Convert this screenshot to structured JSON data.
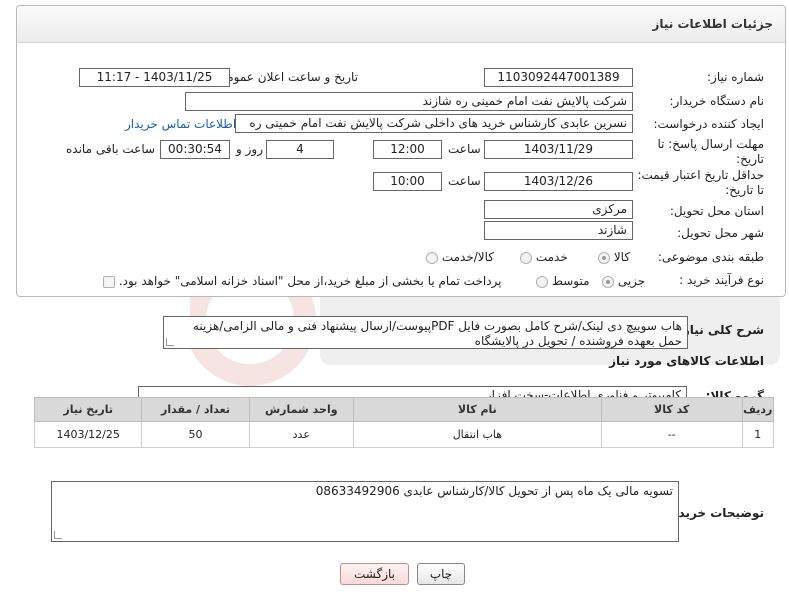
{
  "panel": {
    "title": "جزئیات اطلاعات نیاز"
  },
  "fields": {
    "need_number": {
      "label": "شماره نیاز:",
      "value": "1103092447001389"
    },
    "announce": {
      "label": "تاریخ و ساعت اعلان عمومی:",
      "value": "1403/11/25 - 11:17"
    },
    "buyer_org": {
      "label": "نام دستگاه خریدار:",
      "value": "شرکت پالایش نفت امام خمینی  ره  شازند"
    },
    "requester": {
      "label": "ایجاد کننده درخواست:",
      "value": "نسرین عابدی کارشناس خرید های داخلی  شرکت پالایش نفت امام خمینی  ره",
      "contact_link": "اطلاعات تماس خریدار"
    },
    "deadline": {
      "label": "مهلت ارسال پاسخ: تا تاریخ:",
      "date": "1403/11/29",
      "time_label": "ساعت",
      "time": "12:00",
      "days": "4",
      "days_label": "روز و",
      "remaining": "00:30:54",
      "remaining_label": "ساعت باقی مانده"
    },
    "min_price_validity": {
      "label": "حداقل تاریخ اعتبار قیمت: تا تاریخ:",
      "date": "1403/12/26",
      "time_label": "ساعت",
      "time": "10:00"
    },
    "province": {
      "label": "استان محل تحویل:",
      "value": "مرکزی"
    },
    "city": {
      "label": "شهر محل تحویل:",
      "value": "شازند"
    },
    "category": {
      "label": "طبقه بندی موضوعی:",
      "options": [
        "کالا",
        "خدمت",
        "کالا/خدمت"
      ],
      "selected": "کالا"
    },
    "process": {
      "label": "نوع فرآیند خرید :",
      "options": [
        "جزیی",
        "متوسط"
      ],
      "selected": "جزیی",
      "payment_note": "پرداخت تمام یا بخشی از مبلغ خرید،از محل \"اسناد خزانه اسلامی\" خواهد بود."
    }
  },
  "description": {
    "label": "شرح کلی نیاز:",
    "text": "هاب سوییچ دی لینک/شرح کامل بصورت فایل PDFپیوست/ارسال پیشنهاد فنی و مالی الزامی/هزینه حمل بعهده فروشنده / تحویل در پالایشگاه"
  },
  "goods_section": {
    "title": "اطلاعات کالاهای مورد نیاز",
    "group_label": "گروه کالا:",
    "group_value": "کامپیوتر و فناوری اطلاعات-سخت افزار",
    "columns": [
      "ردیف",
      "کد کالا",
      "نام کالا",
      "واحد شمارش",
      "تعداد / مقدار",
      "تاریخ نیاز"
    ],
    "rows": [
      [
        "1",
        "--",
        "هاب انتقال",
        "عدد",
        "50",
        "1403/12/25"
      ]
    ]
  },
  "buyer_notes": {
    "label": "توضیحات خریدار:",
    "text": "تسویه مالی یک ماه پس از تحویل کالا/کارشناس عابدی 08633492906"
  },
  "buttons": {
    "print": "چاپ",
    "back": "بازگشت"
  },
  "colors": {
    "link": "#1a5fb4",
    "header_bg": "#ececec",
    "table_header_bg": "#d9d9d9"
  }
}
